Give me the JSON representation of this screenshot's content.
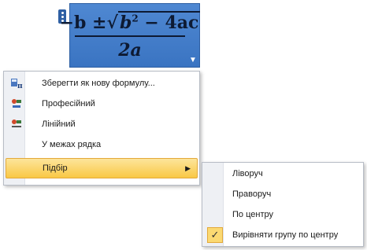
{
  "equation": {
    "minus_b": "−b ±",
    "radicand_b": "b",
    "exp": "2",
    "radicand_rest": " − 4ac",
    "denominator": "2a",
    "dropdown_icon": "chevron-down-icon"
  },
  "menu": {
    "items": [
      {
        "label": "Зберегти як нову формулу...",
        "icon": "save-formula-icon"
      },
      {
        "label": "Професійний",
        "icon": "professional-format-icon"
      },
      {
        "label": "Лінійний",
        "icon": "linear-format-icon"
      },
      {
        "label": "У межах рядка"
      },
      {
        "label": "Підбір",
        "arrow": "▶"
      }
    ]
  },
  "submenu": {
    "items": [
      {
        "label": "Ліворуч"
      },
      {
        "label": "Праворуч"
      },
      {
        "label": "По центру"
      },
      {
        "label": "Вирівняти групу по центру",
        "check": "✓"
      }
    ]
  },
  "colors": {
    "selection": "#3a74c2",
    "highlight": "#f9c845"
  }
}
